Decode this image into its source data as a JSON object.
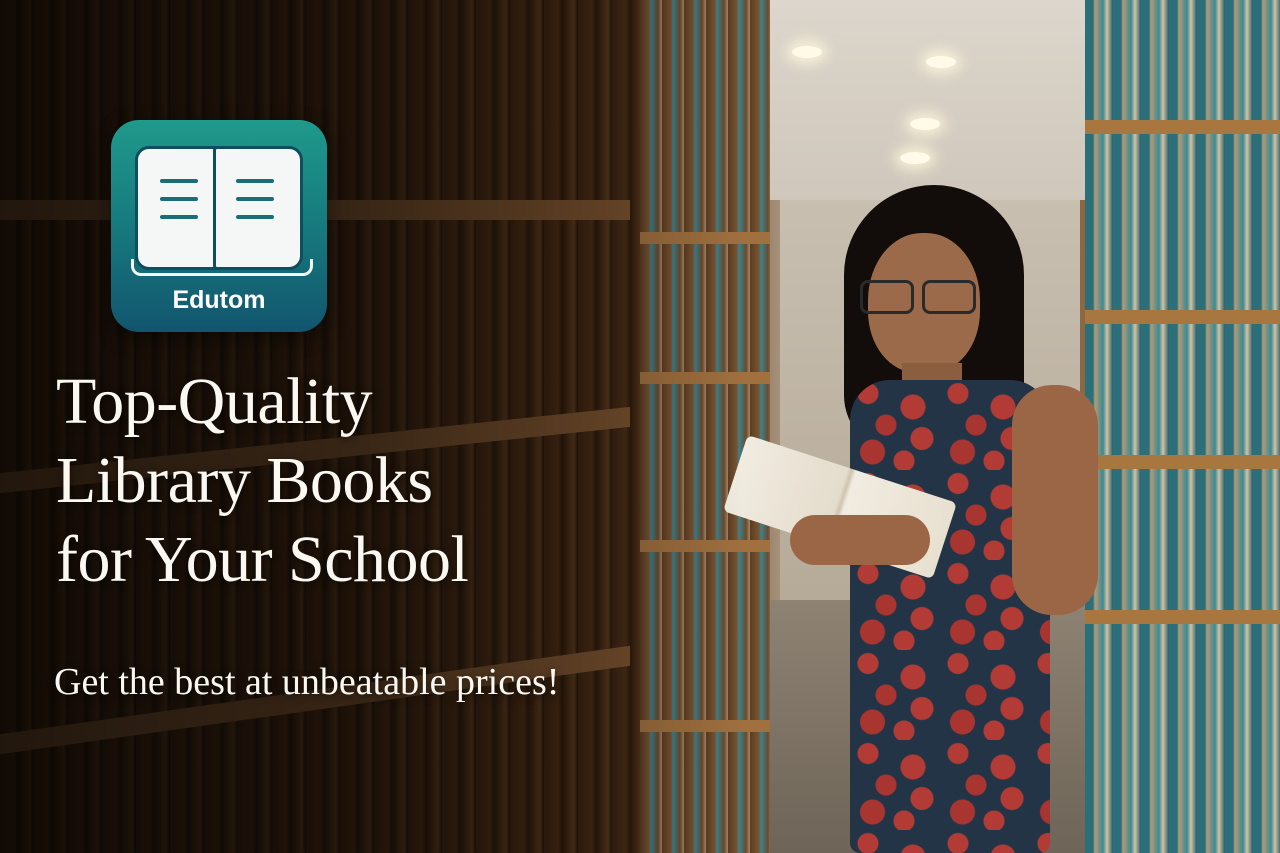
{
  "logo": {
    "brand_name": "Edutom",
    "icon": "open-book-icon",
    "colors": {
      "gradient_top": "#1f9a8b",
      "gradient_bottom": "#12556e",
      "page": "#f4f7f6"
    }
  },
  "hero": {
    "headline_lines": [
      "Top-Quality",
      "Library Books",
      "for Your School"
    ],
    "tagline": "Get the best at unbeatable prices!",
    "text_color": "#fbf8f1"
  },
  "photo": {
    "subject": "woman-reading-book",
    "setting": "library-aisle"
  }
}
